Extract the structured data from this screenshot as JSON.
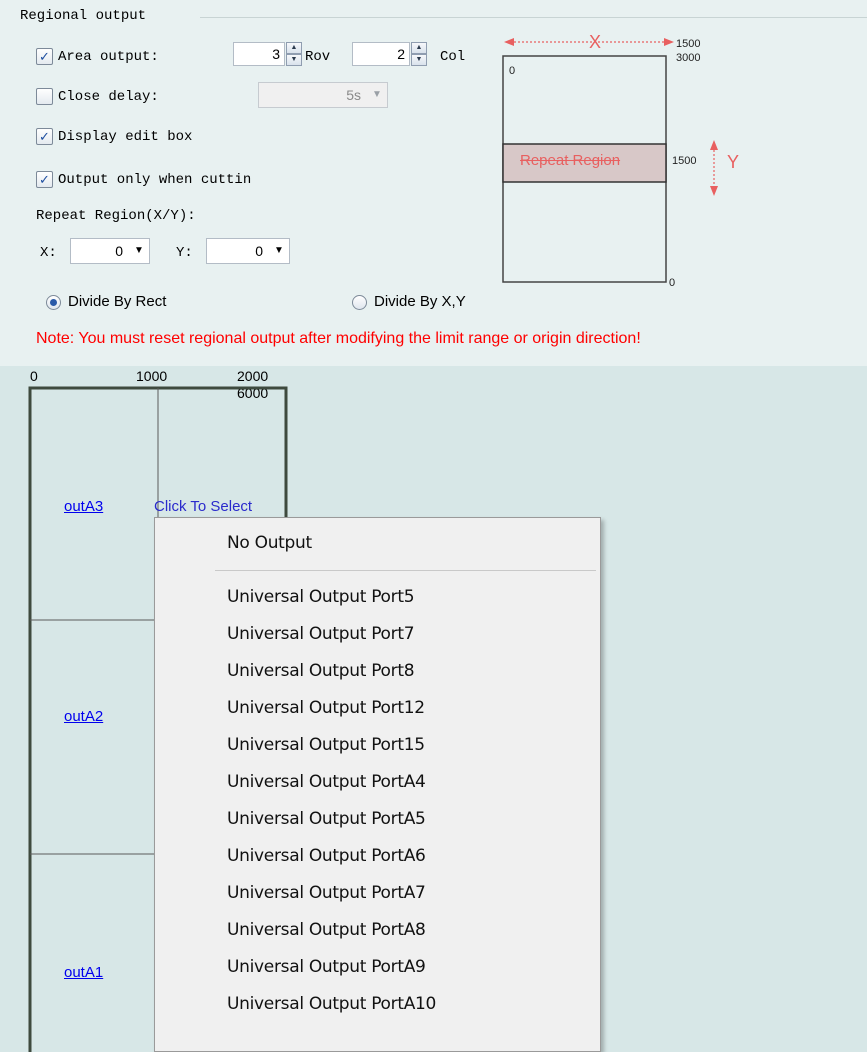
{
  "group": {
    "title": "Regional output"
  },
  "area_output": {
    "label": "Area output:",
    "checked": true,
    "rows_value": "3",
    "row_label": "Rov",
    "cols_value": "2",
    "col_label": "Col"
  },
  "close_delay": {
    "label": "Close delay:",
    "checked": false,
    "value": "5s"
  },
  "display_edit_box": {
    "label": "Display edit box",
    "checked": true
  },
  "output_only": {
    "label": "Output only when cuttin",
    "checked": true
  },
  "repeat_region": {
    "label": "Repeat Region(X/Y):",
    "x_label": "X:",
    "x_value": "0",
    "y_label": "Y:",
    "y_value": "0"
  },
  "divide": {
    "by_rect_label": "Divide By Rect",
    "by_xy_label": "Divide By X,Y",
    "selected": "by_rect"
  },
  "note": "Note: You must reset regional output after modifying the limit range or origin direction!",
  "preview": {
    "x_axis_label": "X",
    "y_axis_label": "Y",
    "x_end": "1500",
    "y_end": "3000",
    "origin": "0",
    "y_mid": "1500",
    "bottom_zero": "0",
    "repeat_label": "Repeat Region"
  },
  "grid": {
    "x_ticks": [
      "0",
      "1000",
      "2000"
    ],
    "y_top": "6000",
    "cells": [
      "outA3",
      "outA2",
      "outA1"
    ],
    "click_to_select": "Click To Select"
  },
  "context_menu": {
    "items": [
      "No Output",
      "Universal Output Port5",
      "Universal Output Port7",
      "Universal Output Port8",
      "Universal Output Port12",
      "Universal Output Port15",
      "Universal Output PortA4",
      "Universal Output PortA5",
      "Universal Output PortA6",
      "Universal Output PortA7",
      "Universal Output PortA8",
      "Universal Output PortA9",
      "Universal Output PortA10"
    ]
  },
  "colors": {
    "note": "#ff0000",
    "link": "#0000ee",
    "repeat": "#e86060",
    "upper_bg": "#e8f1f1",
    "lower_bg": "#d7e7e7"
  }
}
